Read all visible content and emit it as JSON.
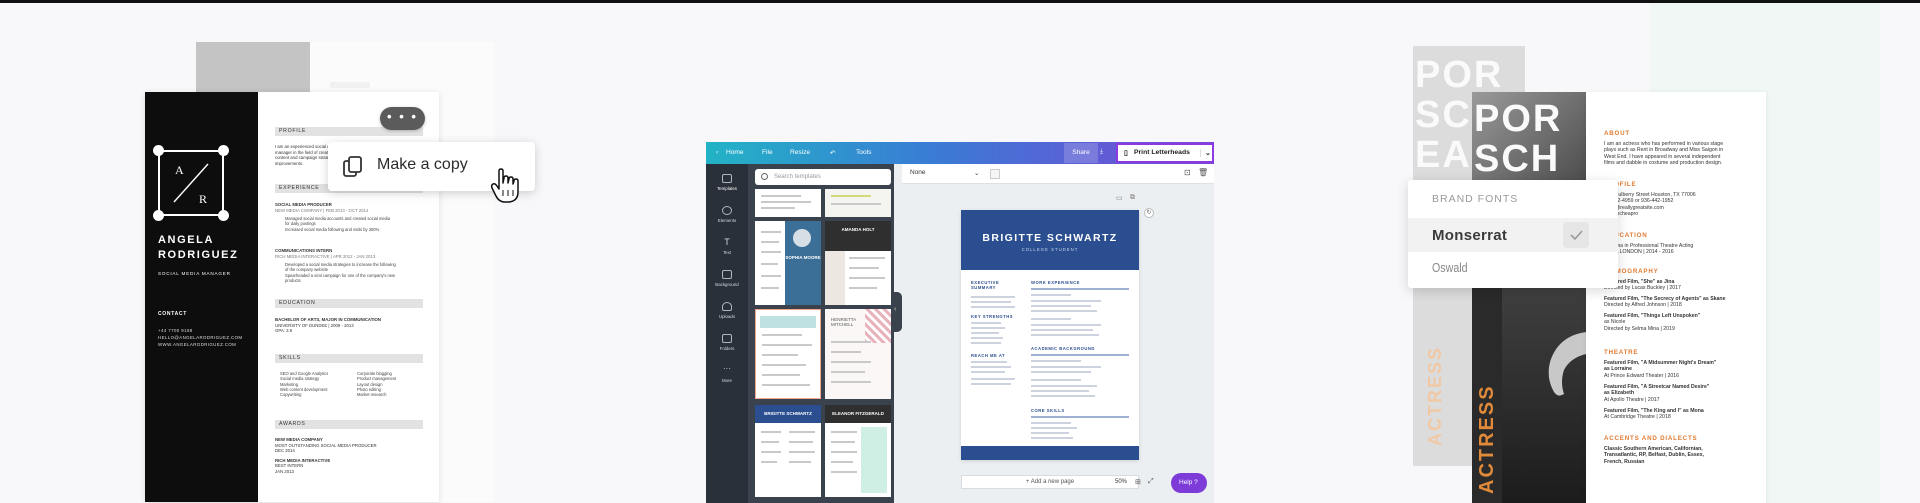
{
  "colors": {
    "accent": "#7d3cd8",
    "canva_teal": "#22b3c6",
    "resume_navy": "#2a4e8f",
    "actress_orange": "#e07b32"
  },
  "left_panel": {
    "more_button": "• • •",
    "copy_label": "Make a copy",
    "resume": {
      "initials": [
        "A",
        "R"
      ],
      "name_lines": [
        "ANGELA",
        "RODRIGUEZ"
      ],
      "job_title": "SOCIAL MEDIA MANAGER",
      "contact_heading": "CONTACT",
      "contact_lines": [
        "+44 7700 9188",
        "HELLO@ANGELARODRIGUEZ.COM",
        "WWW.ANGELARODRIGUEZ.COM"
      ],
      "sections": [
        "PROFILE",
        "EXPERIENCE",
        "EDUCATION",
        "SKILLS",
        "AWARDS"
      ],
      "profile_lines": [
        "I am an experienced social media",
        "manager in the field of creative",
        "content and campaign strategy",
        "improvements."
      ],
      "experience": [
        {
          "title": "SOCIAL MEDIA PRODUCER",
          "org": "NEW MEDIA COMPANY  |  FEB 2013 - OCT 2014",
          "bullets": [
            "Managed social media accounts and created social media",
            "for daily postings",
            "Increased social media following and visits by 300%"
          ]
        },
        {
          "title": "COMMUNICATIONS INTERN",
          "org": "RICH MEDIA INTERACTIVE  |  APR 2012 - JAN 2013",
          "bullets": [
            "Developed a social media strategies to increase the following",
            "of the company website",
            "Spearheaded a viral campaign for one of the company's new",
            "products"
          ]
        }
      ],
      "education": [
        "BACHELOR OF ARTS, MAJOR IN COMMUNICATION",
        "UNIVERSITY OF DUNDEE  |  2009 - 2013",
        "GPA: 3.9"
      ],
      "skills_left": [
        "SEO and Google Analytics",
        "Social media strategy",
        "Marketing",
        "Web content development",
        "Copywriting"
      ],
      "skills_right": [
        "Corporate blogging",
        "Product management",
        "Layout design",
        "Photo editing",
        "Market research"
      ],
      "awards": [
        "NEW MEDIA COMPANY",
        "MOST OUTSTANDING SOCIAL MEDIA PRODUCER",
        "DEC 2014",
        "RICH MEDIA INTERACTIVE",
        "BEST INTERN",
        "JAN 2013"
      ]
    }
  },
  "editor": {
    "top_menu": [
      "Home",
      "File",
      "Resize",
      "Tools"
    ],
    "share_label": "Share",
    "print_label": "Print Letterheads",
    "sidebar": [
      "Templates",
      "Elements",
      "Text",
      "Background",
      "Uploads",
      "Folders",
      "More"
    ],
    "search_placeholder": "Search templates",
    "thumb_titles": [
      "AMANDA HOLT",
      "SOPHIA MOORE",
      "HENRIETTA MITCHELL",
      "BRIGITTE SCHWARTZ",
      "ELEANOR FITZGERALD"
    ],
    "font_select": "None",
    "doc": {
      "name": "BRIGITTE SCHWARTZ",
      "subtitle": "COLLEGE STUDENT",
      "left_sections": [
        "EXECUTIVE SUMMARY",
        "KEY STRENGTHS",
        "REACH ME AT"
      ],
      "right_sections": [
        "WORK EXPERIENCE",
        "ACADEMIC BACKGROUND",
        "CORE SKILLS"
      ]
    },
    "add_page": "+ Add a new page",
    "zoom": "50%",
    "help": "Help  ?"
  },
  "right_panel": {
    "back_big": [
      "POR",
      "SCP",
      "EASCH"
    ],
    "front_big": [
      "POR",
      "SCH"
    ],
    "vertical_text": "ACTRESS",
    "fonts_title": "BRAND FONTS",
    "font_selected": "Monserrat",
    "font_other": "Oswald",
    "sections": [
      "ABOUT",
      "PROFILE",
      "EDUCATION",
      "FILMOGRAPHY",
      "THEATRE",
      "ACCENTS AND DIALECTS"
    ],
    "about": [
      "I am an actress who has performed in various stage",
      "plays such as Rent in Broadway and Miss Saigon in",
      "West End. I have appeared in several independent",
      "films and dabble in costume and production design."
    ],
    "profile": [
      "127 Mulberry Street Houston, TX 77006",
      "+1-442-4959 or 936-442-1952",
      "hello@reallygreatsite.com",
      "@porscheapro"
    ],
    "education": [
      "Diploma in Professional Theatre Acting",
      "RADA LONDON  |  2014 - 2016"
    ],
    "filmography": [
      [
        "Featured Film, \"She\" as Jina",
        "Directed by Lucas Buckley  |  2017"
      ],
      [
        "Featured Film, \"The Secrecy of Agents\" as Skane",
        "Directed by Alfred Johnson  |  2018"
      ],
      [
        "Featured Film, \"Things Left Unspoken\"",
        "as Nicole",
        "Directed by Selma Mina  |  2019"
      ]
    ],
    "theatre": [
      [
        "Featured Film, \"A Midsummer Night's Dream\"",
        "as Lorraine",
        "At Prince Edward Theater  |  2016"
      ],
      [
        "Featured Film, \"A Streetcar Named Desire\"",
        "as Elizabeth",
        "At Apollo Theatre  |  2017"
      ],
      [
        "Featured Film, \"The King and I\" as Mona",
        "At Cambridge Theatre  |  2018"
      ]
    ],
    "accents": [
      "Classic Southern American, Californian,",
      "Transatlantic, RP, Belfast, Dublin, Essex,",
      "French, Russian"
    ]
  }
}
